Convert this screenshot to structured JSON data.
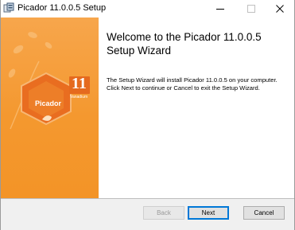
{
  "window": {
    "title": "Picador 11.0.0.5 Setup",
    "icon": "installer-icon",
    "controls": [
      "minimize-icon",
      "maximize-icon",
      "close-icon"
    ]
  },
  "branding": {
    "logo_text": "Picador",
    "version_badge": "11",
    "badge_caption": "Vanadium",
    "panel_color": "#f4982f"
  },
  "content": {
    "heading": "Welcome to the Picador 11.0.0.5 Setup Wizard",
    "body": "The Setup Wizard will install Picador 11.0.0.5 on your computer. Click Next to continue or Cancel to exit the Setup Wizard."
  },
  "buttons": {
    "back": "Back",
    "next": "Next",
    "cancel": "Cancel"
  }
}
